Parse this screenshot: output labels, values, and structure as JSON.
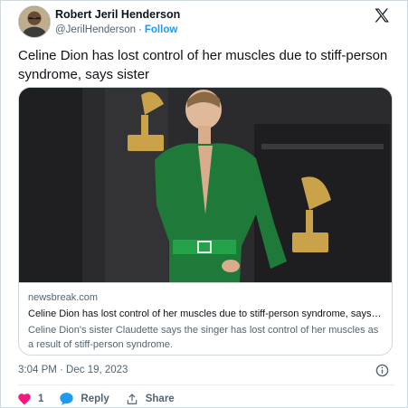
{
  "tweet": {
    "author_name": "Robert Jeril Henderson",
    "author_handle": "@JerilHenderson",
    "separator": "·",
    "follow_label": "Follow",
    "text": "Celine Dion has lost control of her muscles due to stiff-person syndrome, says sister",
    "timestamp": "3:04 PM · Dec 19, 2023",
    "likes_count": "1",
    "reply_label": "Reply",
    "share_label": "Share"
  },
  "card": {
    "domain": "newsbreak.com",
    "title": "Celine Dion has lost control of her muscles due to stiff-person syndrome, says…",
    "description": "Celine Dion's sister Claudette says the singer has lost control of her muscles as a result of stiff-person syndrome."
  },
  "icons": {
    "logo": "x-logo-icon",
    "like": "heart-icon",
    "reply": "speech-bubble-icon",
    "share": "share-icon",
    "info": "info-icon"
  },
  "colors": {
    "accent": "#1d9bf0",
    "like": "#f91880",
    "text": "#0f1419",
    "muted": "#536471"
  }
}
